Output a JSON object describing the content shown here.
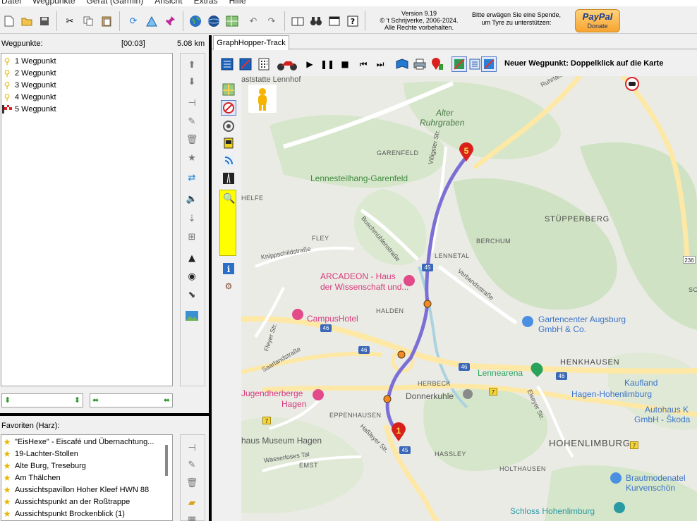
{
  "menu": [
    "Datei",
    "Wegpunkte",
    "Gerät (Garmin)",
    "Ansicht",
    "Extras",
    "Hilfe"
  ],
  "version": {
    "line1": "Version 9.19",
    "line2": "© 't Schrijverke, 2006-2024.",
    "line3": "Alle Rechte vorbehalten."
  },
  "donate": {
    "line1": "Bitte erwägen Sie eine Spende,",
    "line2": "um Tyre zu unterstützen:",
    "paypal": "PayPal",
    "button": "Donate"
  },
  "waypoints": {
    "label": "Wegpunkte:",
    "time": "[00:03]",
    "distance": "5.08 km",
    "items": [
      {
        "label": "1 Wegpunkt",
        "icon": "pin-icon"
      },
      {
        "label": "2 Wegpunkt",
        "icon": "pin-icon"
      },
      {
        "label": "3 Wegpunkt",
        "icon": "pin-icon"
      },
      {
        "label": "4 Wegpunkt",
        "icon": "pin-icon"
      },
      {
        "label": "5 Wegpunkt",
        "icon": "finish-flag-icon"
      }
    ]
  },
  "favorites": {
    "label": "Favoriten (Harz):",
    "items": [
      "\"EisHexe\" - Eiscafé und Übernachtung...",
      "19-Lachter-Stollen",
      "Alte Burg, Treseburg",
      "Am Thälchen",
      "Aussichtspavillon Hoher Kleef HWN 88",
      "Aussichtspunkt an der Roßtrappe",
      "Aussichtspunkt Brockenblick (1)"
    ]
  },
  "tab": {
    "label": "GraphHopper-Track"
  },
  "hint": "Neuer Wegpunkt: Doppelklick auf die Karte",
  "map": {
    "labels": {
      "bahnhof": "aststatte Lennhof",
      "alter": "Alter",
      "ruhrgraben": "Ruhrgraben",
      "garenfeld": "GARENFELD",
      "lennesteilhang": "Lennesteilhang-Garenfeld",
      "villigster": "Villigster Str.",
      "buschmuehlen": "Buschmühlenstraße",
      "helfe": "HELFE",
      "fley": "FLEY",
      "knipp": "Knippschildstraße",
      "stupperberg": "STÜPPERBERG",
      "berchum": "BERCHUM",
      "lennetal": "LENNETAL",
      "verbands": "Verbandsstraße",
      "arcadeon1": "ARCADEON - Haus",
      "arcadeon2": "der Wissenschaft und...",
      "halden": "HALDEN",
      "campus": "CampusHotel",
      "fleyer": "Fleyer Str.",
      "gartencenter1": "Gartencenter Augsburg",
      "gartencenter2": "GmbH & Co.",
      "saarland": "Saarlandstraße",
      "henkhausen": "HENKHAUSEN",
      "lennearena": "Lennearena",
      "kaufland1": "Kaufland",
      "kaufland2": "Hagen-Hohenlimburg",
      "herbeck": "HERBECK",
      "jugend1": "Jugendherberge",
      "jugend2": "Hagen",
      "donnerkuhle": "Donnerkuhle",
      "eppenhausen": "EPPENHAUSEN",
      "elseyer": "Elseyer Str.",
      "autohaus1": "Autohaus K",
      "autohaus2": "GmbH - Škoda",
      "museum": "haus Museum Hagen",
      "hasslerstr": "Haßleyer Str.",
      "hohenlimburg": "HOHENLIMBURG",
      "wasserloses": "Wasserloses Tal",
      "emst": "EMST",
      "hassley": "HASSLEY",
      "holthausen": "HOLTHAUSEN",
      "braut1": "Brautmodenatel",
      "braut2": "Kurvenschön",
      "schloss": "Schloss Hohenlimburg",
      "ruhrtal": "Ruhrtals",
      "so": "SC",
      "r46a": "46",
      "r46b": "46",
      "r46c": "46",
      "r46d": "46",
      "r45a": "45",
      "r45b": "45",
      "r7a": "7",
      "r7b": "7",
      "r7c": "7",
      "r236": "236",
      "m1": "1",
      "m5": "5"
    }
  },
  "colors": {
    "route": "#7b6fd6",
    "marker": "#d9201a",
    "waypoint": "#f08a24",
    "park": "#cfe3c4",
    "water": "#aad3df",
    "road": "#fde8a6"
  }
}
